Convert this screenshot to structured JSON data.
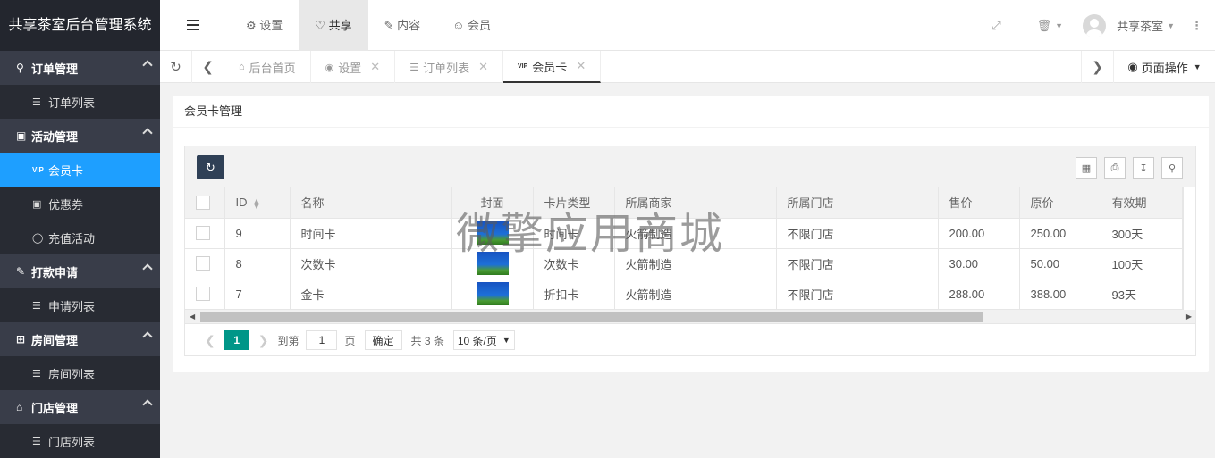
{
  "app_title": "共享茶室后台管理系统",
  "sidebar": {
    "groups": [
      {
        "label": "订单管理",
        "icon": "search-doc-icon",
        "items": [
          {
            "label": "订单列表"
          }
        ]
      },
      {
        "label": "活动管理",
        "icon": "gift-icon",
        "items": [
          {
            "label": "会员卡"
          },
          {
            "label": "优惠券"
          },
          {
            "label": "充值活动"
          }
        ]
      },
      {
        "label": "打款申请",
        "icon": "edit-icon",
        "items": [
          {
            "label": "申请列表"
          }
        ]
      },
      {
        "label": "房间管理",
        "icon": "room-icon",
        "items": [
          {
            "label": "房间列表"
          }
        ]
      },
      {
        "label": "门店管理",
        "icon": "home-icon",
        "items": [
          {
            "label": "门店列表"
          }
        ]
      }
    ],
    "active_item": "会员卡"
  },
  "header": {
    "topnav": [
      {
        "label": "设置",
        "icon": "gear-icon"
      },
      {
        "label": "共享",
        "icon": "heart-icon"
      },
      {
        "label": "内容",
        "icon": "edit-icon"
      },
      {
        "label": "会员",
        "icon": "user-icon"
      }
    ],
    "active_topnav": "共享",
    "user_name": "共享茶室"
  },
  "tabs": [
    {
      "label": "后台首页",
      "icon": "home-icon",
      "closable": false
    },
    {
      "label": "设置",
      "icon": "palette-icon",
      "closable": true
    },
    {
      "label": "订单列表",
      "icon": "list-icon",
      "closable": true
    },
    {
      "label": "会员卡",
      "icon": "vip-icon",
      "closable": true
    }
  ],
  "active_tab": "会员卡",
  "page_ops_label": "页面操作",
  "card_title": "会员卡管理",
  "table": {
    "columns": [
      "ID",
      "名称",
      "封面",
      "卡片类型",
      "所属商家",
      "所属门店",
      "售价",
      "原价",
      "有效期"
    ],
    "rows": [
      {
        "id": "9",
        "name": "时间卡",
        "type": "时间卡",
        "merchant": "火箭制造",
        "store": "不限门店",
        "price": "200.00",
        "orig": "250.00",
        "valid": "300天"
      },
      {
        "id": "8",
        "name": "次数卡",
        "type": "次数卡",
        "merchant": "火箭制造",
        "store": "不限门店",
        "price": "30.00",
        "orig": "50.00",
        "valid": "100天"
      },
      {
        "id": "7",
        "name": "金卡",
        "type": "折扣卡",
        "merchant": "火箭制造",
        "store": "不限门店",
        "price": "288.00",
        "orig": "388.00",
        "valid": "93天"
      }
    ]
  },
  "pager": {
    "current": "1",
    "goto_label": "到第",
    "goto_value": "1",
    "page_label": "页",
    "confirm": "确定",
    "total": "共 3 条",
    "page_size": "10 条/页"
  },
  "watermark": "微擎应用商城",
  "colors": {
    "sidebar_bg": "#393d49",
    "sidebar_active": "#1e9fff",
    "pager_active": "#009688",
    "refresh_btn": "#2f4056"
  }
}
